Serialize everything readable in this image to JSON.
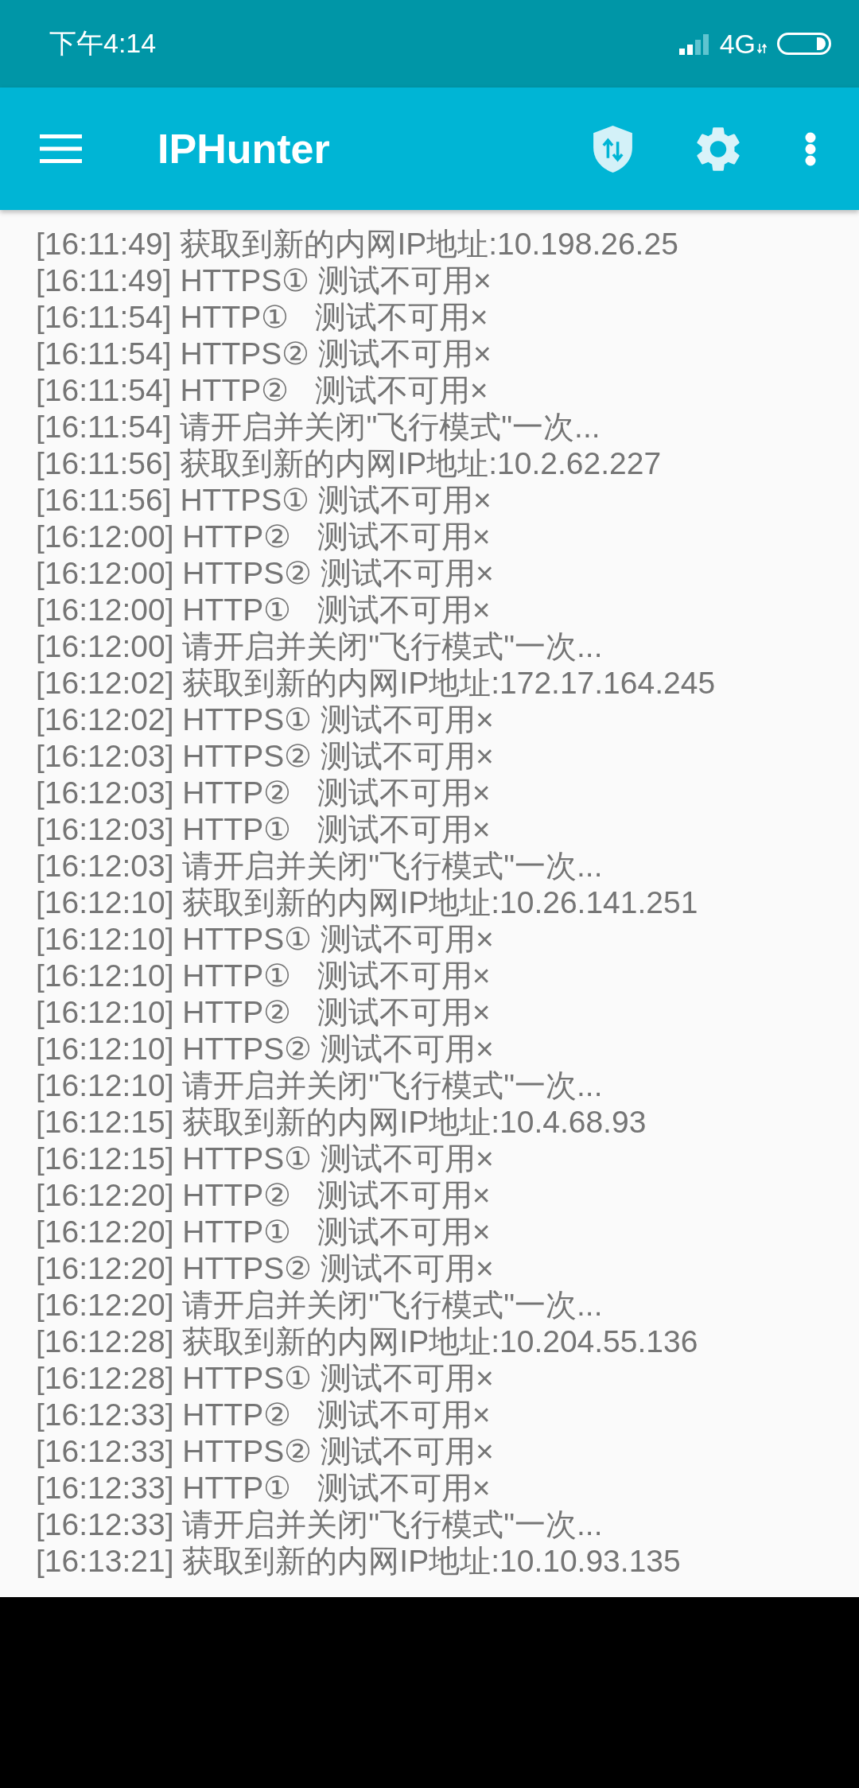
{
  "status_bar": {
    "time": "下午4:14",
    "network": "4G"
  },
  "app_bar": {
    "title": "IPHunter"
  },
  "log": [
    {
      "text": "[16:11:49] 获取到新的内网IP地址:10.198.26.25"
    },
    {
      "text": "[16:11:49] HTTPS① 测试不可用×"
    },
    {
      "text": "[16:11:54] HTTP①   测试不可用×"
    },
    {
      "text": "[16:11:54] HTTPS② 测试不可用×"
    },
    {
      "text": "[16:11:54] HTTP②   测试不可用×"
    },
    {
      "text": "[16:11:54] 请开启并关闭\"飞行模式\"一次..."
    },
    {
      "text": "[16:11:56] 获取到新的内网IP地址:10.2.62.227"
    },
    {
      "text": "[16:11:56] HTTPS① 测试不可用×"
    },
    {
      "text": "[16:12:00] HTTP②   测试不可用×"
    },
    {
      "text": "[16:12:00] HTTPS② 测试不可用×"
    },
    {
      "text": "[16:12:00] HTTP①   测试不可用×"
    },
    {
      "text": "[16:12:00] 请开启并关闭\"飞行模式\"一次..."
    },
    {
      "text": "[16:12:02] 获取到新的内网IP地址:172.17.164.245"
    },
    {
      "text": "[16:12:02] HTTPS① 测试不可用×"
    },
    {
      "text": "[16:12:03] HTTPS② 测试不可用×"
    },
    {
      "text": "[16:12:03] HTTP②   测试不可用×"
    },
    {
      "text": "[16:12:03] HTTP①   测试不可用×"
    },
    {
      "text": "[16:12:03] 请开启并关闭\"飞行模式\"一次..."
    },
    {
      "text": "[16:12:10] 获取到新的内网IP地址:10.26.141.251"
    },
    {
      "text": "[16:12:10] HTTPS① 测试不可用×"
    },
    {
      "text": "[16:12:10] HTTP①   测试不可用×"
    },
    {
      "text": "[16:12:10] HTTP②   测试不可用×"
    },
    {
      "text": "[16:12:10] HTTPS② 测试不可用×"
    },
    {
      "text": "[16:12:10] 请开启并关闭\"飞行模式\"一次..."
    },
    {
      "text": "[16:12:15] 获取到新的内网IP地址:10.4.68.93"
    },
    {
      "text": "[16:12:15] HTTPS① 测试不可用×"
    },
    {
      "text": "[16:12:20] HTTP②   测试不可用×"
    },
    {
      "text": "[16:12:20] HTTP①   测试不可用×"
    },
    {
      "text": "[16:12:20] HTTPS② 测试不可用×"
    },
    {
      "text": "[16:12:20] 请开启并关闭\"飞行模式\"一次..."
    },
    {
      "text": "[16:12:28] 获取到新的内网IP地址:10.204.55.136"
    },
    {
      "text": "[16:12:28] HTTPS① 测试不可用×"
    },
    {
      "text": "[16:12:33] HTTP②   测试不可用×"
    },
    {
      "text": "[16:12:33] HTTPS② 测试不可用×"
    },
    {
      "text": "[16:12:33] HTTP①   测试不可用×"
    },
    {
      "text": "[16:12:33] 请开启并关闭\"飞行模式\"一次..."
    },
    {
      "text": "[16:13:21] 获取到新的内网IP地址:10.10.93.135"
    }
  ]
}
